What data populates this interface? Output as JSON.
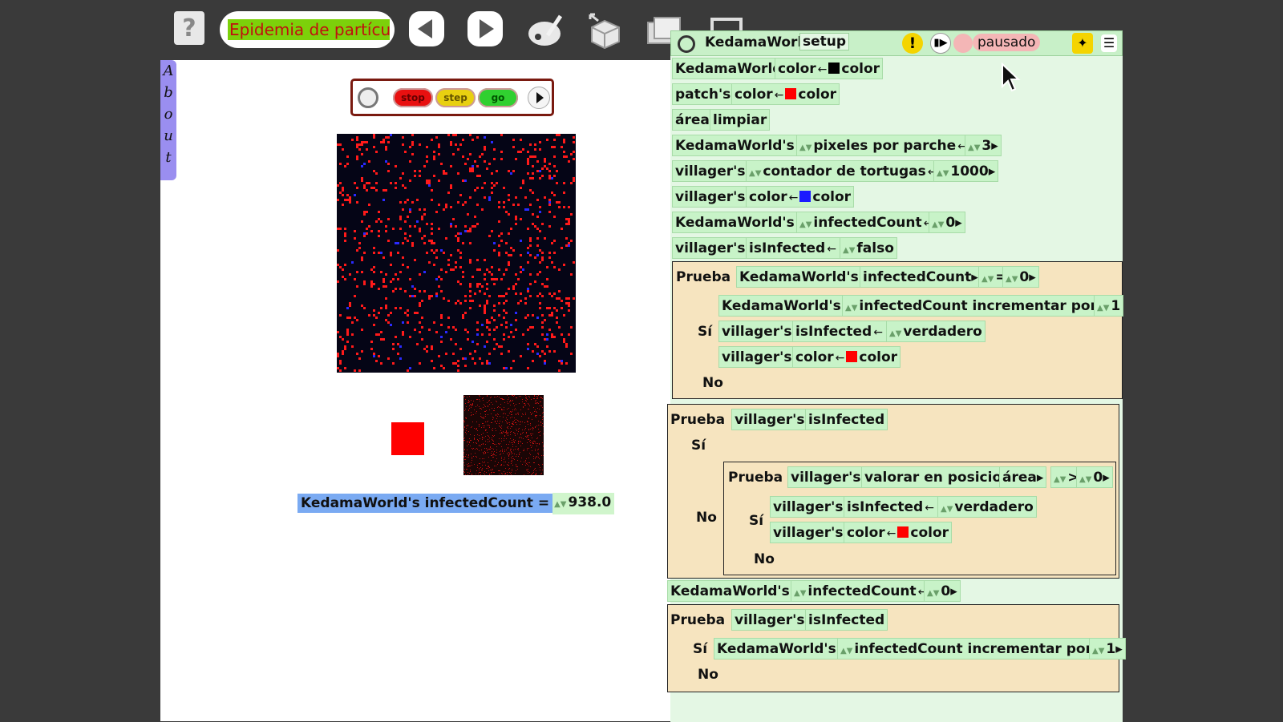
{
  "toolbar": {
    "help_label": "?",
    "project_title": "Epidemia de partícu"
  },
  "about_tab": {
    "letters": [
      "A",
      "b",
      "o",
      "u",
      "t"
    ]
  },
  "controls": {
    "stop": "stop",
    "step": "step",
    "go": "go"
  },
  "watcher": {
    "label": "KedamaWorld's infectedCount =",
    "value": "938.0"
  },
  "script_header": {
    "object": "KedamaWorld",
    "script_name": "setup",
    "status": "pausado",
    "warning": "!"
  },
  "lines": {
    "l1": {
      "obj": "KedamaWorld's",
      "prop": "color",
      "val": "color"
    },
    "l2": {
      "obj": "patch's",
      "prop": "color",
      "val": "color"
    },
    "l3": {
      "obj": "área",
      "cmd": "limpiar"
    },
    "l4": {
      "obj": "KedamaWorld's",
      "prop": "pixeles por parche",
      "val": "3"
    },
    "l5": {
      "obj": "villager's",
      "prop": "contador de tortugas",
      "val": "1000"
    },
    "l6": {
      "obj": "villager's",
      "prop": "color",
      "val": "color"
    },
    "l7": {
      "obj": "KedamaWorld's",
      "prop": "infectedCount",
      "val": "0"
    },
    "l8": {
      "obj": "villager's",
      "prop": "isInfected",
      "val": "falso"
    }
  },
  "test1": {
    "label": "Prueba",
    "obj": "KedamaWorld's",
    "prop": "infectedCount",
    "op": "=",
    "val": "0",
    "yes": "Sí",
    "no": "No",
    "yes1": {
      "obj": "KedamaWorld's",
      "prop": "infectedCount incrementar por",
      "val": "1"
    },
    "yes2": {
      "obj": "villager's",
      "prop": "isInfected",
      "val": "verdadero"
    },
    "yes3": {
      "obj": "villager's",
      "prop": "color",
      "val": "color"
    }
  },
  "test2": {
    "label": "Prueba",
    "obj": "villager's",
    "prop": "isInfected",
    "yes": "Sí",
    "no": "No",
    "inner": {
      "label": "Prueba",
      "obj": "villager's",
      "prop": "valorar en posicion",
      "arg": "área",
      "op": ">",
      "val": "0",
      "yes": "Sí",
      "no": "No",
      "yes1": {
        "obj": "villager's",
        "prop": "isInfected",
        "val": "verdadero"
      },
      "yes2": {
        "obj": "villager's",
        "prop": "color",
        "val": "color"
      }
    }
  },
  "l9": {
    "obj": "KedamaWorld's",
    "prop": "infectedCount",
    "val": "0"
  },
  "test3": {
    "label": "Prueba",
    "obj": "villager's",
    "prop": "isInfected",
    "yes": "Sí",
    "no": "No",
    "yes1": {
      "obj": "KedamaWorld's",
      "prop": "infectedCount incrementar por",
      "val": "1"
    }
  },
  "colors": {
    "black_swatch": "#000000",
    "red_swatch": "#ff0000",
    "blue_swatch": "#1a1aff"
  }
}
